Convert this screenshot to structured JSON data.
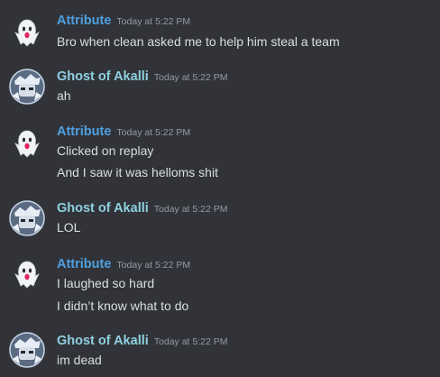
{
  "colors": {
    "background": "#313338",
    "attribute_name": "#4f9fe0",
    "ghost_name": "#8fd0e0",
    "timestamp": "#949ba4",
    "message_text": "#dbdee1"
  },
  "messages": [
    {
      "author": "Attribute",
      "avatar_icon": "ghost-avatar-icon",
      "timestamp": "Today at 5:22 PM",
      "lines": [
        "Bro when clean asked me to help him steal a team"
      ]
    },
    {
      "author": "Ghost of Akalli",
      "avatar_icon": "anime-avatar-icon",
      "timestamp": "Today at 5:22 PM",
      "lines": [
        "ah"
      ]
    },
    {
      "author": "Attribute",
      "avatar_icon": "ghost-avatar-icon",
      "timestamp": "Today at 5:22 PM",
      "lines": [
        "Clicked on replay",
        "And I saw it was helloms shit"
      ]
    },
    {
      "author": "Ghost of Akalli",
      "avatar_icon": "anime-avatar-icon",
      "timestamp": "Today at 5:22 PM",
      "lines": [
        "LOL"
      ]
    },
    {
      "author": "Attribute",
      "avatar_icon": "ghost-avatar-icon",
      "timestamp": "Today at 5:22 PM",
      "lines": [
        "I laughed so hard",
        "I didn’t know what to do"
      ]
    },
    {
      "author": "Ghost of Akalli",
      "avatar_icon": "anime-avatar-icon",
      "timestamp": "Today at 5:22 PM",
      "lines": [
        "im dead"
      ]
    }
  ]
}
